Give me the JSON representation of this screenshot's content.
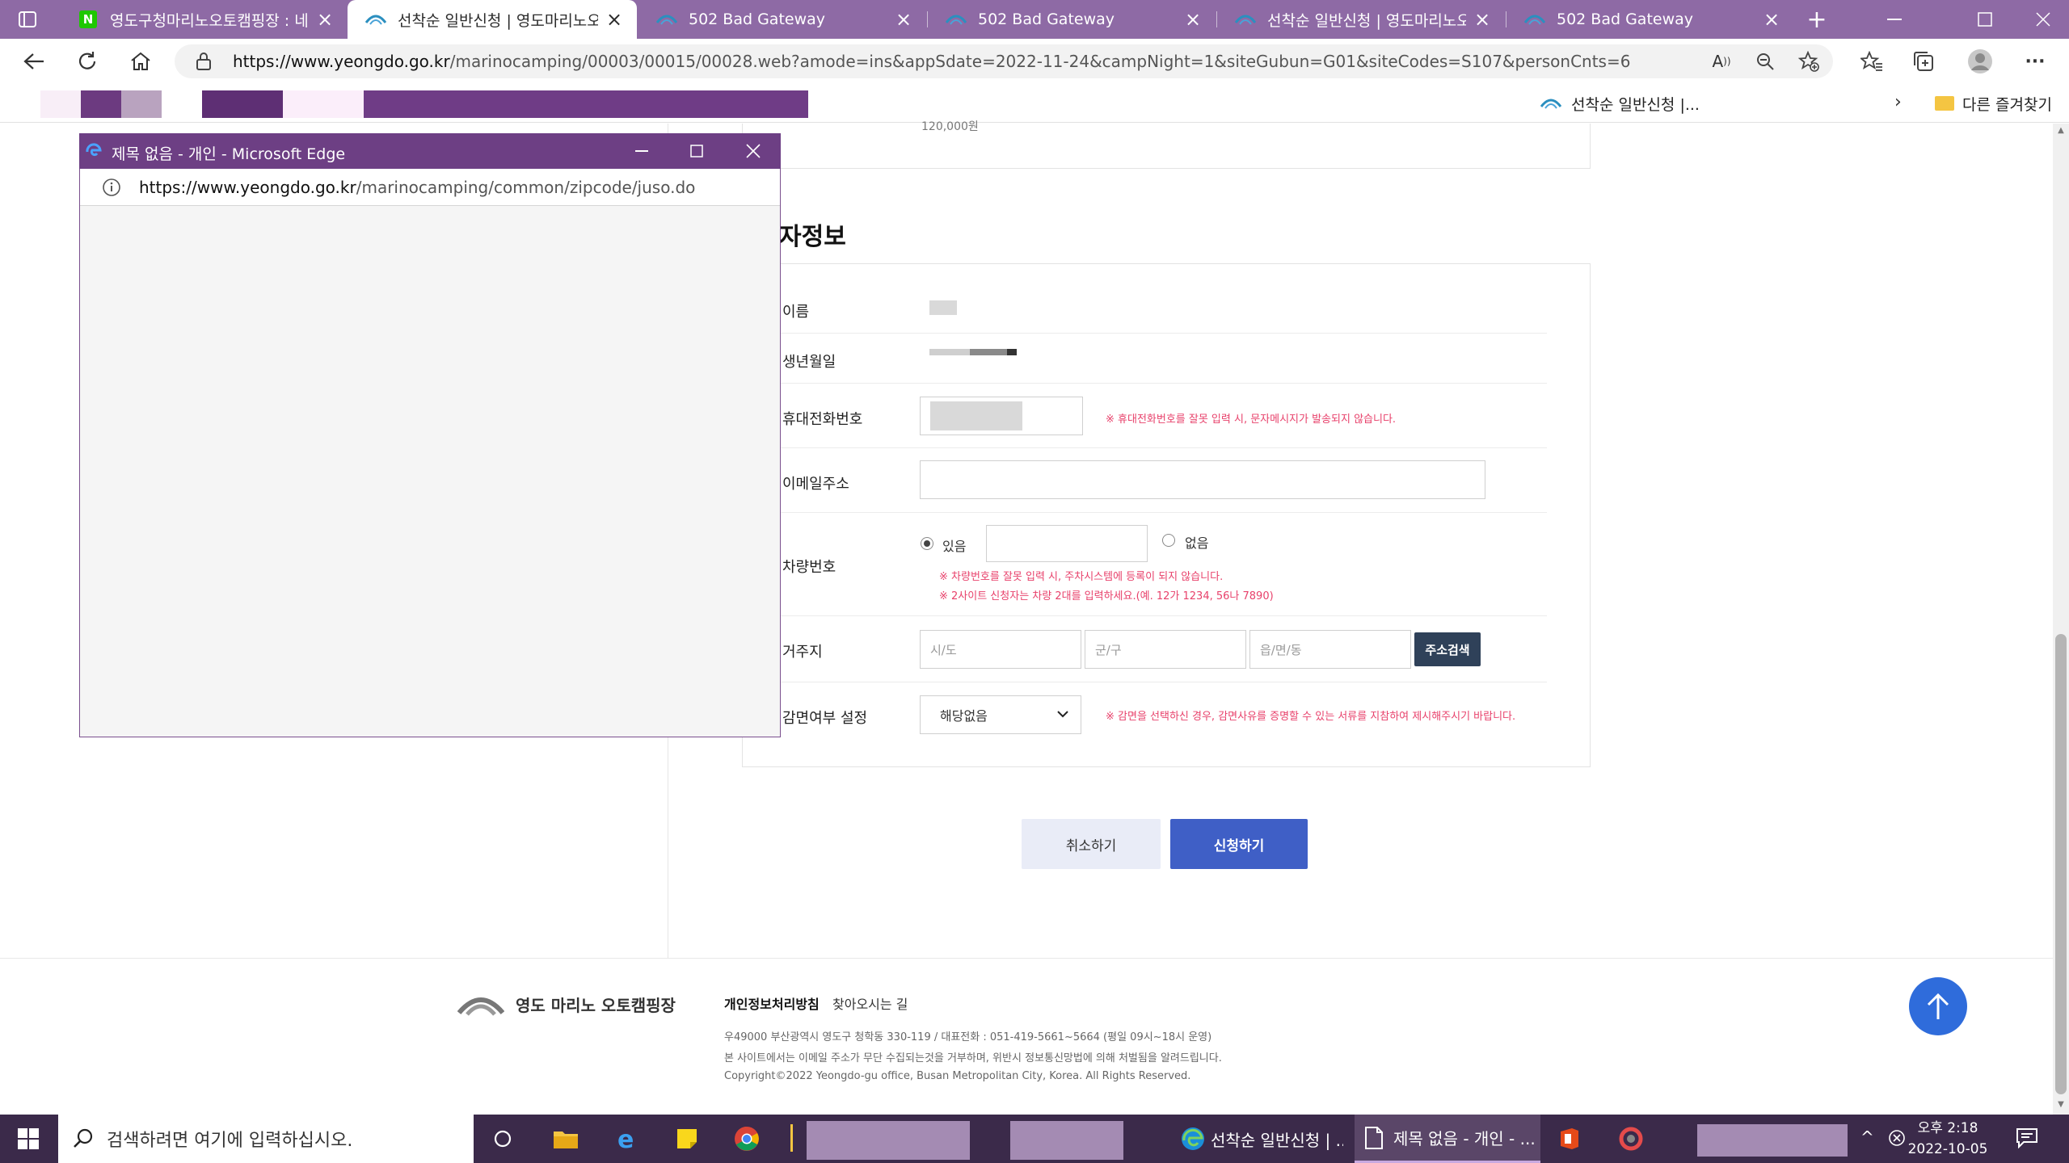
{
  "browser": {
    "tabs": [
      {
        "title": "영도구청마리노오토캠핑장 : 네이",
        "icon": "naver-icon",
        "active": false
      },
      {
        "title": "선착순 일반신청 | 영도마리노오토",
        "icon": "yeongdo-icon",
        "active": true
      },
      {
        "title": "502 Bad Gateway",
        "icon": "yeongdo-icon",
        "active": false
      },
      {
        "title": "502 Bad Gateway",
        "icon": "yeongdo-icon",
        "active": false
      },
      {
        "title": "선착순 일반신청 | 영도마리노오토",
        "icon": "yeongdo-icon",
        "active": false
      },
      {
        "title": "502 Bad Gateway",
        "icon": "yeongdo-icon",
        "active": false
      }
    ],
    "url_host": "https://www.yeongdo.go.kr",
    "url_path": "/marinocamping/00003/00015/00028.web?amode=ins&appSdate=2022-11-24&campNight=1&siteGubun=G01&siteCodes=S107&personCnts=6",
    "favorites": {
      "item": "선착순 일반신청 |...",
      "other": "다른 즐겨찾기"
    }
  },
  "popup": {
    "title": "제목 없음 - 개인 - Microsoft Edge",
    "url_host": "https://www.yeongdo.go.kr",
    "url_path": "/marinocamping/common/zipcode/juso.do"
  },
  "form": {
    "section_title": "자정보",
    "prev_value": "120,000원",
    "name_label": "이름",
    "birth_label": "생년월일",
    "phone_label": "휴대전화번호",
    "phone_note": "※ 휴대전화번호를 잘못 입력 시, 문자메시지가 발송되지 않습니다.",
    "email_label": "이메일주소",
    "car_label": "차량번호",
    "car_yes": "있음",
    "car_no": "없음",
    "car_note1": "※ 차량번호를 잘못 입력 시, 주차시스템에 등록이 되지 않습니다.",
    "car_note2": "※ 2사이트 신청자는 차량 2대를 입력하세요.(예. 12가 1234, 56나 7890)",
    "address_label": "거주지",
    "addr_sido_ph": "시/도",
    "addr_gugun_ph": "군/구",
    "addr_dong_ph": "읍/면/동",
    "addr_search_btn": "주소검색",
    "discount_label": "감면여부 설정",
    "discount_selected": "해당없음",
    "discount_note": "※ 감면을 선택하신 경우, 감면사유를 증명할 수 있는 서류를 지참하여 제시해주시기 바랍니다.",
    "cancel_btn": "취소하기",
    "apply_btn": "신청하기"
  },
  "footer": {
    "logo_text": "영도 마리노 오토캠핑장",
    "link_privacy": "개인정보처리방침",
    "link_directions": "찾아오시는 길",
    "address": "우49000 부산광역시 영도구 청학동 330-119  /  대표전화 : 051-419-5661~5664 (평일 09시~18시 운영)",
    "email_policy": "본 사이트에서는 이메일 주소가 무단 수집되는것을 거부하며, 위반시 정보통신망법에 의해 처벌됨을 알려드립니다.",
    "copyright": "Copyright©2022 Yeongdo-gu office, Busan Metropolitan City, Korea. All Rights Reserved."
  },
  "taskbar": {
    "search_placeholder": "검색하려면 여기에 입력하십시오.",
    "item_edge": "선착순 일반신청 | ...",
    "item_popup": "제목 없음 - 개인 - ...",
    "time": "오후 2:18",
    "date": "2022-10-05"
  },
  "colors": {
    "tabstrip": "#8e6aa5",
    "popup_title": "#6d3f84",
    "apply_button": "#3f5fc6",
    "note_red": "#e8416b",
    "taskbar": "#3b2a4a"
  }
}
